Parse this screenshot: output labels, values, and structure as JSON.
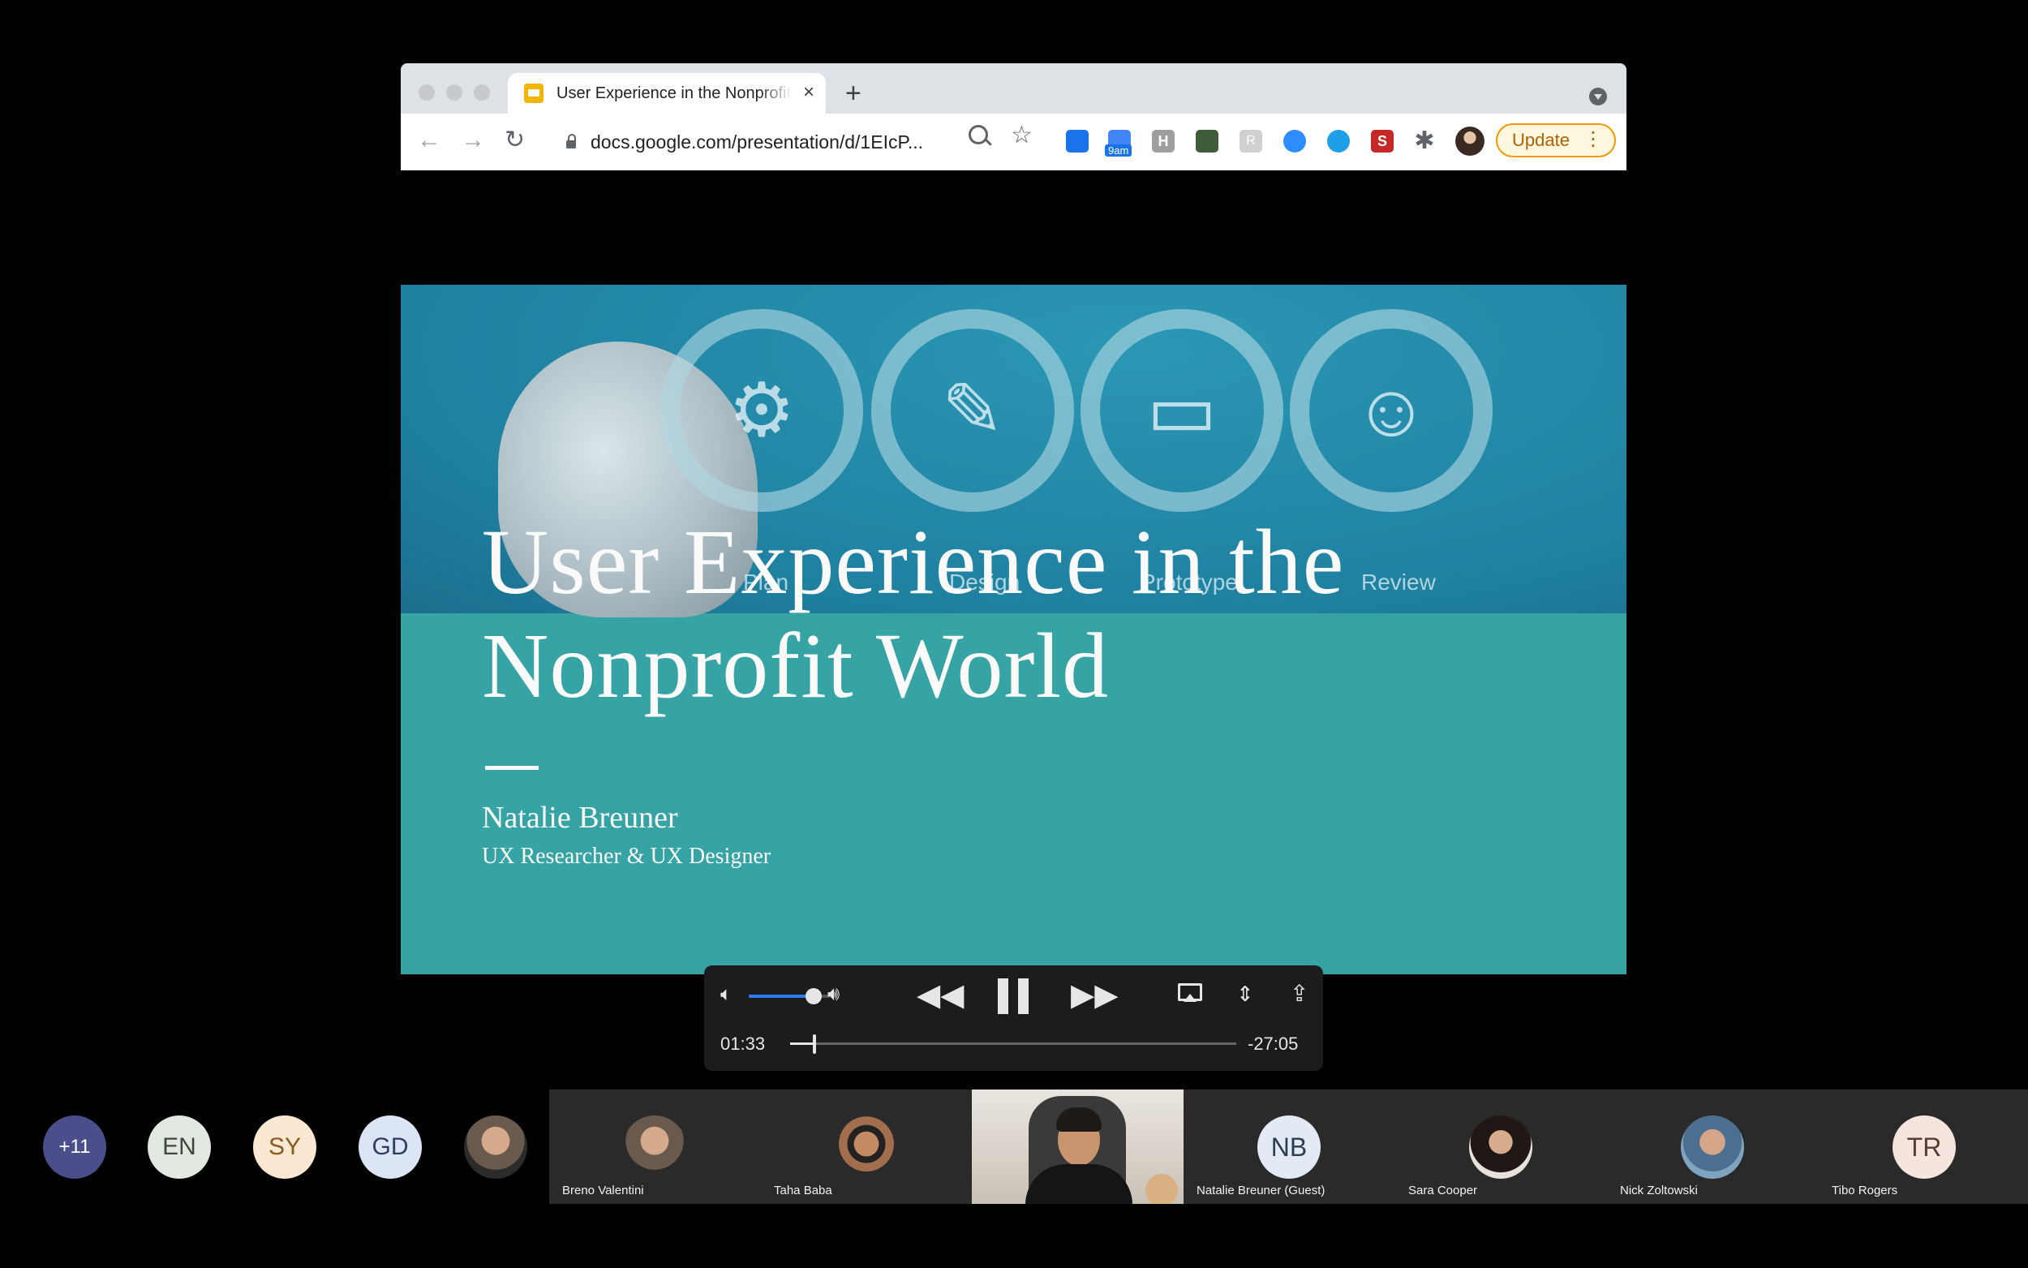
{
  "browser": {
    "tab_title": "User Experience in the Nonprofit World - Google Slides",
    "tab_close": "×",
    "new_tab": "+",
    "url": "docs.google.com/presentation/d/1EIcP...",
    "update_label": "Update",
    "extensions": [
      "calendar-icon",
      "calendar-9am-icon",
      "h-extension-icon",
      "dollar-extension-icon",
      "r-extension-icon",
      "zoom-extension-icon",
      "bluetooth-extension-icon",
      "s-extension-icon",
      "puzzle-icon"
    ],
    "calendar_badge": "9am",
    "h_ext": "H",
    "r_ext": "R",
    "s_ext": "S",
    "puzzle": "✱"
  },
  "slide": {
    "title_line1": "User Experience in the",
    "title_line2": "Nonprofit World",
    "presenter": "Natalie Breuner",
    "role": "UX Researcher & UX Designer",
    "steps": [
      "Plan",
      "Design",
      "Prototype",
      "Review"
    ],
    "colors": {
      "top": "#1f80a0",
      "bottom": "#36a3a5",
      "text": "#fafafa"
    }
  },
  "player": {
    "current_time": "01:33",
    "remaining_time": "-27:05",
    "volume": 0.8,
    "progress": 0.055
  },
  "participants": {
    "overflow": "+11",
    "initials": [
      "EN",
      "SY",
      "GD"
    ],
    "tiles": [
      {
        "name": "Breno Valentini",
        "kind": "photo"
      },
      {
        "name": "Taha Baba",
        "kind": "photo"
      },
      {
        "name": "",
        "kind": "video"
      },
      {
        "name": "Natalie Breuner (Guest)",
        "kind": "initials",
        "initials": "NB"
      },
      {
        "name": "Sara Cooper",
        "kind": "photo"
      },
      {
        "name": "Nick Zoltowski",
        "kind": "photo"
      },
      {
        "name": "Tibo Rogers",
        "kind": "initials",
        "initials": "TR"
      }
    ]
  }
}
